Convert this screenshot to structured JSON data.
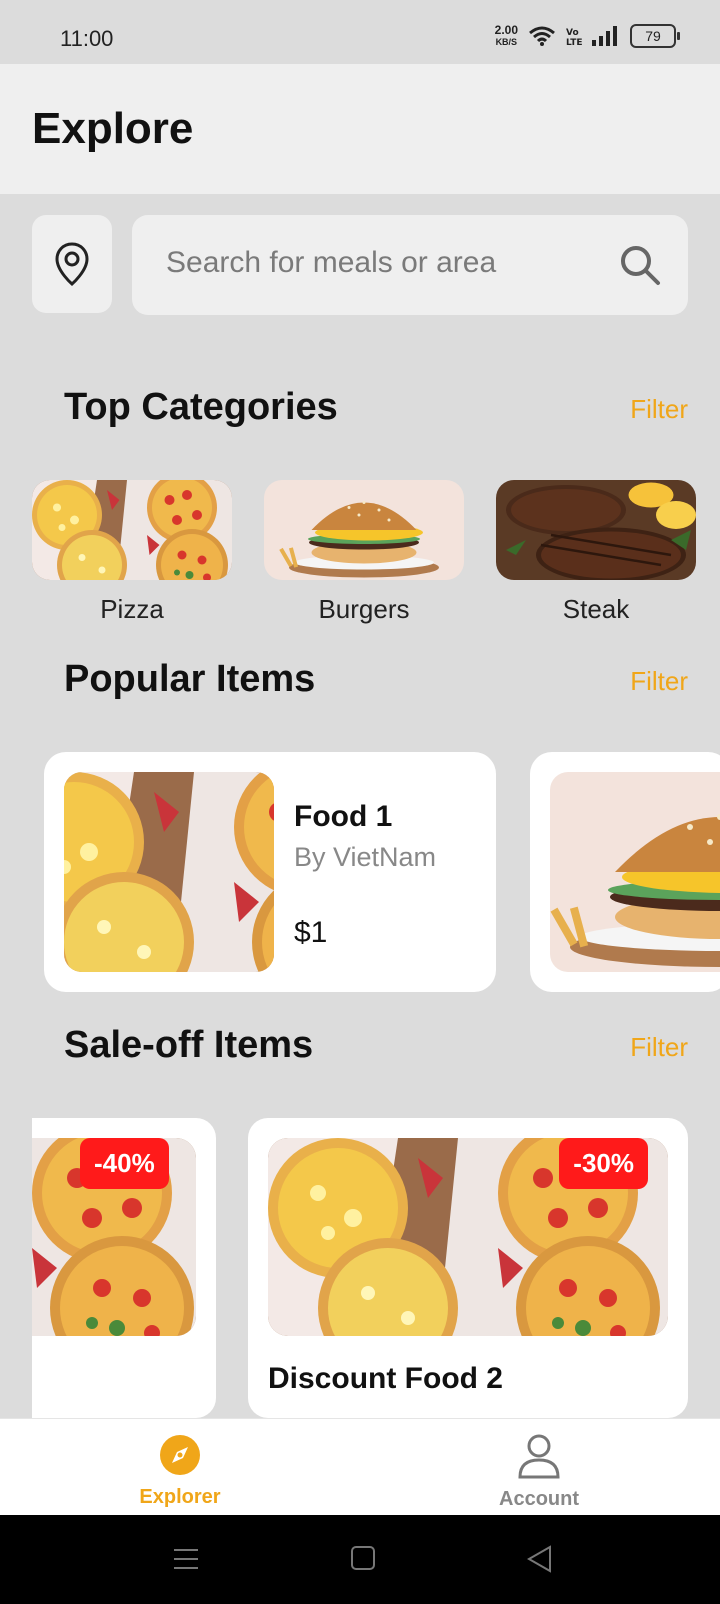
{
  "status_bar": {
    "time": "11:00",
    "net_speed_value": "2.00",
    "net_speed_unit": "KB/S",
    "battery": "79"
  },
  "header": {
    "title": "Explore"
  },
  "search": {
    "placeholder": "Search for meals or area",
    "value": ""
  },
  "top_categories": {
    "title": "Top Categories",
    "filter_label": "Filter",
    "items": [
      {
        "label": "Pizza"
      },
      {
        "label": "Burgers"
      },
      {
        "label": "Steak"
      }
    ]
  },
  "popular": {
    "title": "Popular Items",
    "filter_label": "Filter",
    "items": [
      {
        "name": "Food 1",
        "by": "By VietNam",
        "price": "$1"
      }
    ]
  },
  "sale_off": {
    "title": "Sale-off Items",
    "filter_label": "Filter",
    "items": [
      {
        "discount": "-40%"
      },
      {
        "discount": "-30%",
        "name": "Discount Food 2"
      }
    ]
  },
  "bottom_nav": {
    "items": [
      {
        "label": "Explorer",
        "active": true
      },
      {
        "label": "Account",
        "active": false
      }
    ]
  },
  "colors": {
    "accent": "#f0a619",
    "badge": "#ff1a1a",
    "background": "#dcdcdc"
  },
  "icons": [
    "location-pin-icon",
    "search-icon",
    "compass-icon",
    "user-icon",
    "menu-icon",
    "home-square-icon",
    "back-triangle-icon",
    "wifi-icon",
    "signal-icon",
    "battery-icon"
  ]
}
